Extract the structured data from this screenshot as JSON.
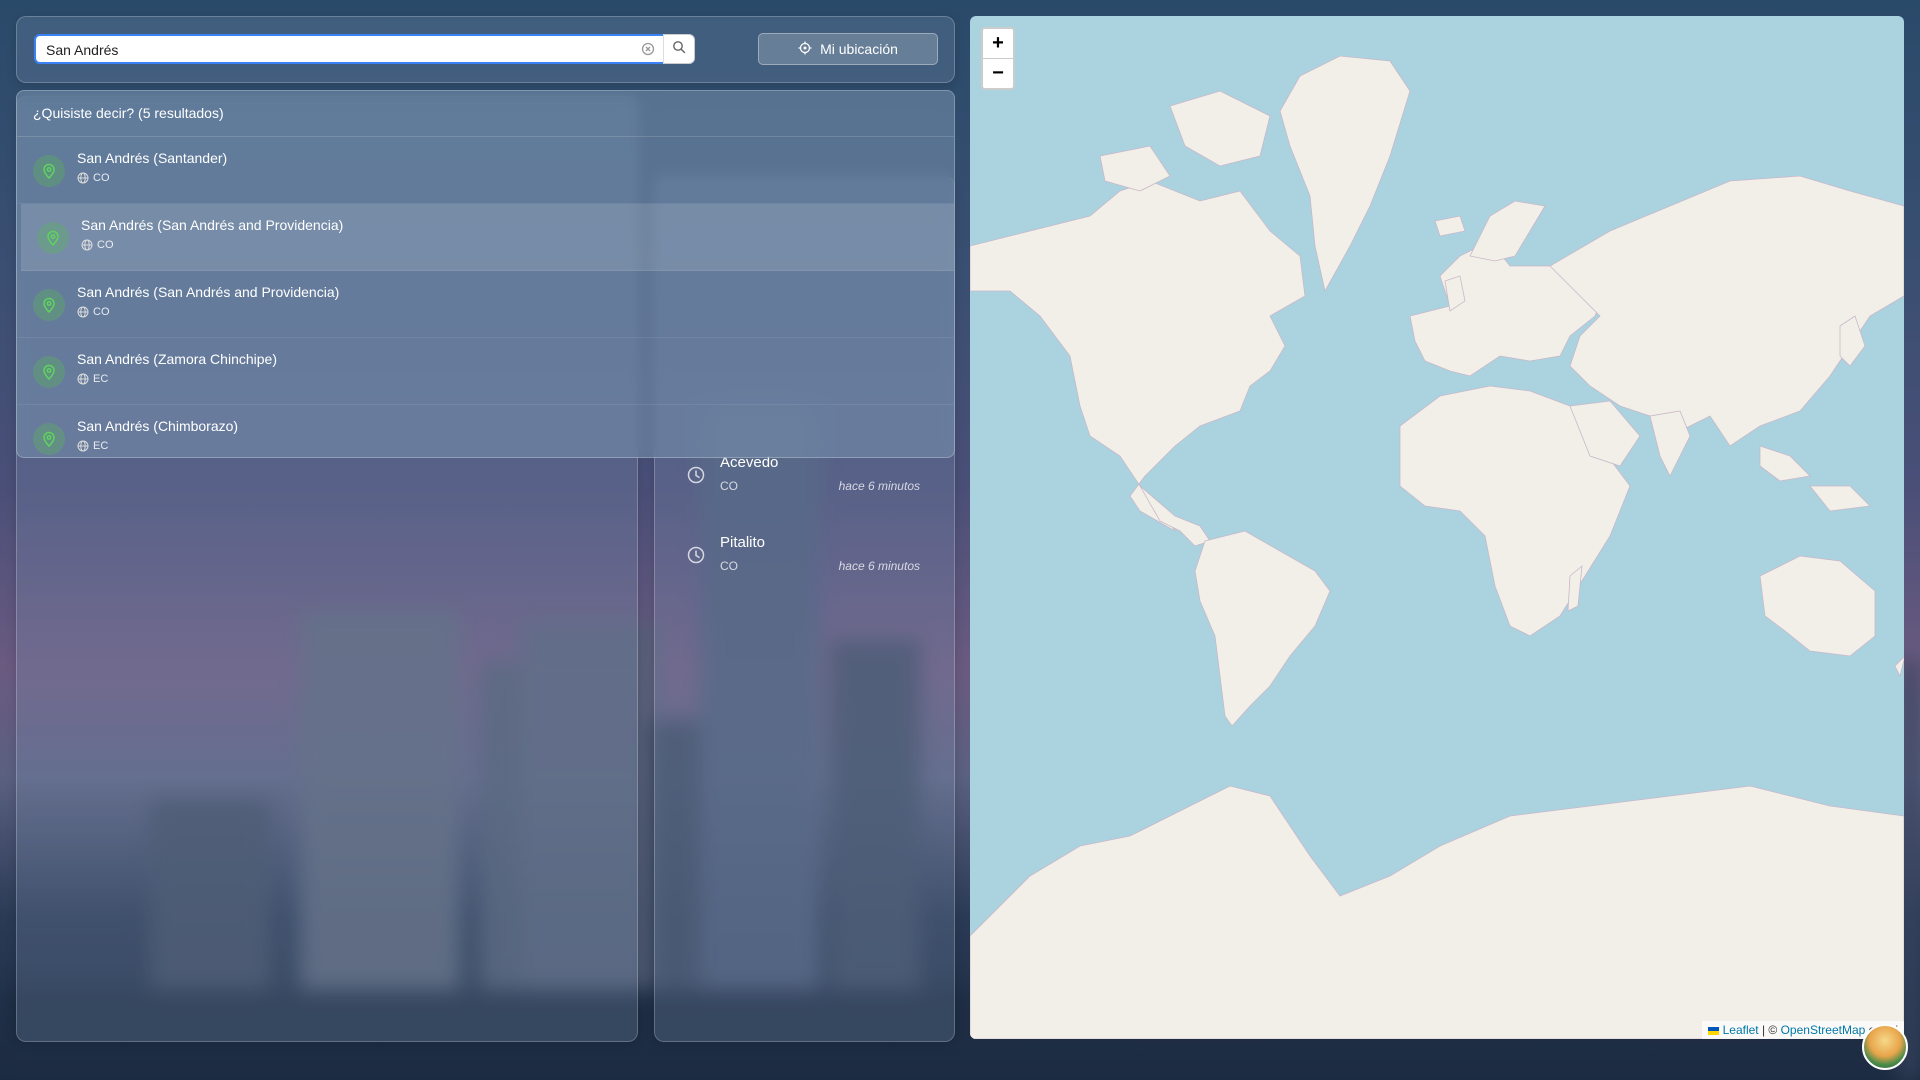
{
  "search": {
    "value": "San Andrés",
    "placeholder": "",
    "location_button_label": "Mi ubicación"
  },
  "dropdown": {
    "header": "¿Quisiste decir? (5 resultados)",
    "items": [
      {
        "title": "San Andrés (Santander)",
        "country": "CO"
      },
      {
        "title": "San Andrés (San Andrés and Providencia)",
        "country": "CO"
      },
      {
        "title": "San Andrés (San Andrés and Providencia)",
        "country": "CO"
      },
      {
        "title": "San Andrés (Zamora Chinchipe)",
        "country": "EC"
      },
      {
        "title": "San Andrés (Chimborazo)",
        "country": "EC"
      }
    ]
  },
  "recent": {
    "items": [
      {
        "name": "Acevedo",
        "country": "CO",
        "ago": "hace 6 minutos"
      },
      {
        "name": "Pitalito",
        "country": "CO",
        "ago": "hace 6 minutos"
      }
    ]
  },
  "map": {
    "zoom_in": "+",
    "zoom_out": "−",
    "attribution_leaflet": "Leaflet",
    "attribution_sep": " | © ",
    "attribution_osm": "OpenStreetMap",
    "attribution_tail": " contri"
  },
  "colors": {
    "accent": "#3b82f6",
    "pin_green": "#5fd35f",
    "map_water": "#aad3df",
    "map_land": "#f2efe9"
  }
}
